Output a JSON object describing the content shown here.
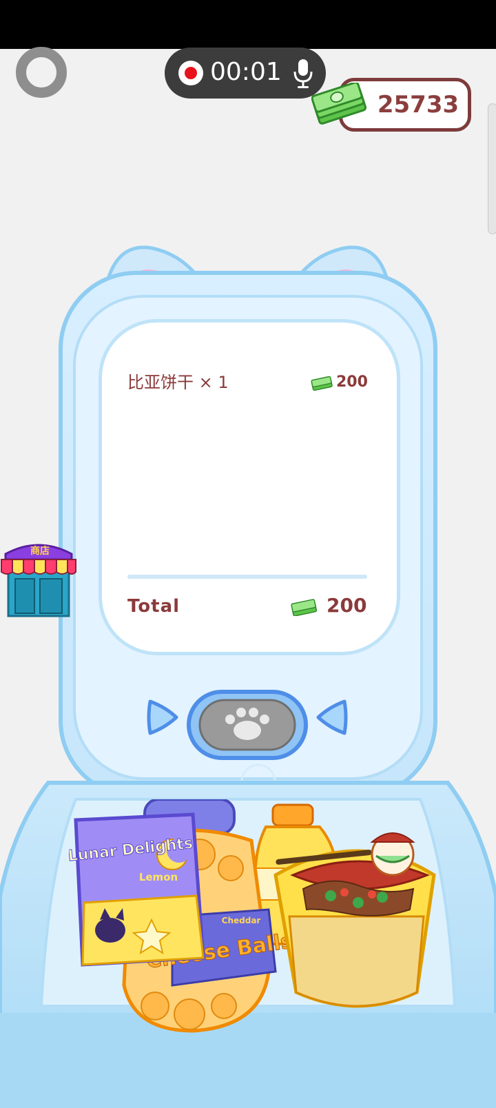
{
  "recorder": {
    "time": "00:01"
  },
  "wallet": {
    "coins": "25733"
  },
  "receipt": {
    "item_name": "比亚饼干 × 1",
    "item_price": "200",
    "total_label": "Total",
    "total_value": "200"
  },
  "shop": {
    "label": "商店"
  },
  "snacks": {
    "chips_brand": "Lunar Delights",
    "chips_flavor": "Lemon",
    "jar_label": "Cheese Balls",
    "jar_flavor": "Cheddar"
  },
  "colors": {
    "coin_text": "#8b3e3e",
    "machine_blue": "#bfe3f8",
    "record_red": "#e8121c"
  }
}
